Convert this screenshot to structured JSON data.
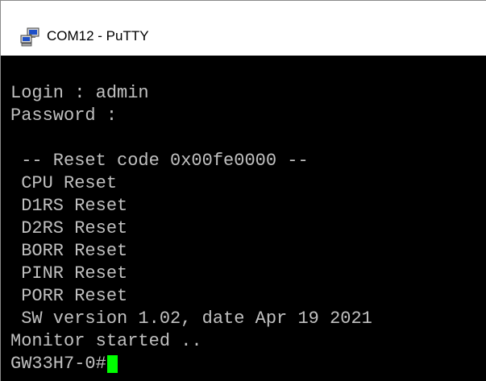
{
  "window": {
    "title": "COM12 - PuTTY",
    "app_icon": "putty-computers-icon"
  },
  "terminal": {
    "lines": [
      "Login : admin",
      "Password :",
      "",
      " -- Reset code 0x00fe0000 --",
      " CPU Reset",
      " D1RS Reset",
      " D2RS Reset",
      " BORR Reset",
      " PINR Reset",
      " PORR Reset",
      " SW version 1.02, date Apr 19 2021",
      "Monitor started .."
    ],
    "prompt": "GW33H7-0#",
    "colors": {
      "background": "#000000",
      "foreground": "#c0c0c0",
      "cursor": "#00ff00"
    }
  }
}
